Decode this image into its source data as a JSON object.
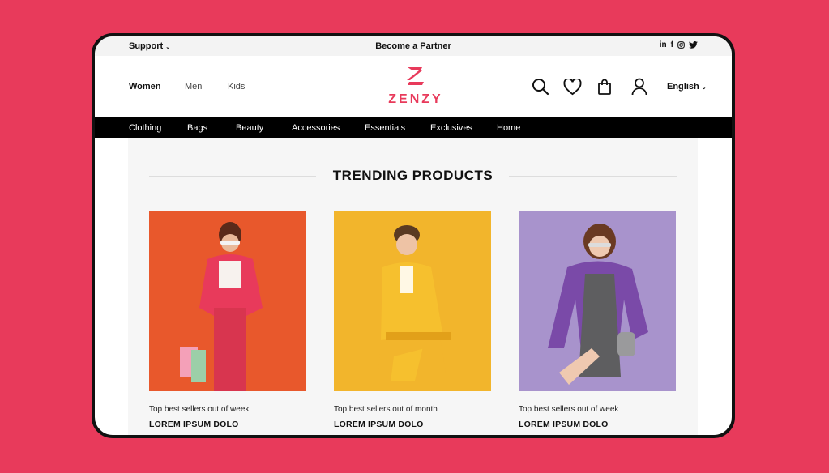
{
  "topbar": {
    "support": "Support",
    "partner": "Become a Partner",
    "social": [
      "in",
      "f"
    ]
  },
  "header": {
    "genders": [
      "Women",
      "Men",
      "Kids"
    ],
    "brand": "ZENZY",
    "language": "English"
  },
  "nav": [
    "Clothing",
    "Bags",
    "Beauty",
    "Accessories",
    "Essentials",
    "Exclusives",
    "Home"
  ],
  "section": {
    "title": "TRENDING PRODUCTS"
  },
  "products": [
    {
      "caption": "Top best sellers out of  week",
      "name": "LOREM IPSUM DOLO",
      "bg": "#e8582c"
    },
    {
      "caption": "Top best sellers out of month",
      "name": "LOREM IPSUM DOLO",
      "bg": "#f2b52c"
    },
    {
      "caption": "Top best sellers out of  week",
      "name": "LOREM IPSUM DOLO",
      "bg": "#a893cc"
    }
  ],
  "colors": {
    "accent": "#e83a5b",
    "page_bg": "#e83a5b",
    "nav_bg": "#000000"
  }
}
